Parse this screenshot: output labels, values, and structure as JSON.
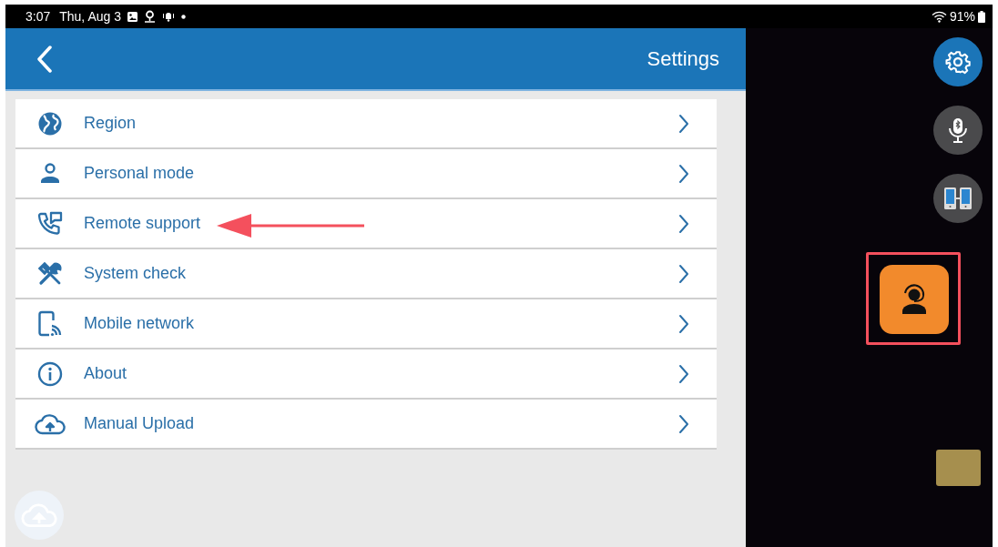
{
  "status_bar": {
    "time": "3:07",
    "date": "Thu, Aug 3",
    "battery": "91%"
  },
  "header": {
    "title": "Settings"
  },
  "settings": [
    {
      "label": "Region"
    },
    {
      "label": "Personal mode"
    },
    {
      "label": "Remote support"
    },
    {
      "label": "System check"
    },
    {
      "label": "Mobile network"
    },
    {
      "label": "About"
    },
    {
      "label": "Manual Upload"
    }
  ],
  "side_buttons": [
    {
      "kind": "settings",
      "selected": true
    },
    {
      "kind": "mic",
      "selected": false
    },
    {
      "kind": "devices",
      "selected": false
    }
  ],
  "annotations": {
    "arrow": true,
    "highlight_box": true
  }
}
